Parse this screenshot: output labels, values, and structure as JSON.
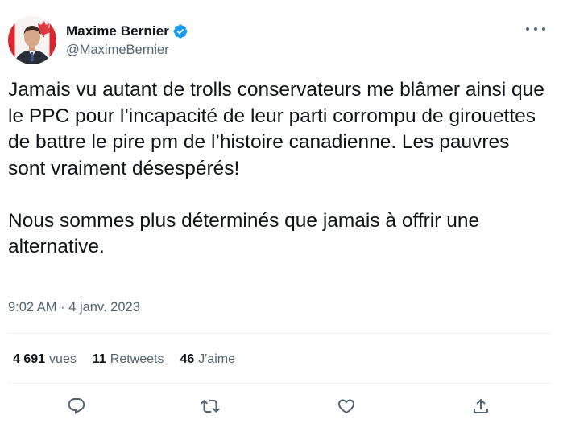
{
  "author": {
    "display_name": "Maxime Bernier",
    "handle": "@MaximeBernier",
    "verified": true,
    "verified_color": "#1d9bf0",
    "avatar_icon": "profile-photo-canada-flag"
  },
  "tweet": {
    "text": "Jamais vu autant de trolls conservateurs me blâmer ainsi que le PPC pour l’incapacité de leur parti corrompu de girouettes de battre le pire pm de l’histoire canadienne. Les pauvres sont vraiment désespérés!\n\nNous sommes plus déterminés que jamais à offrir une alternative.",
    "timestamp": "9:02 AM · 4 janv. 2023"
  },
  "stats": {
    "views_count": "4 691",
    "views_label": "vues",
    "retweets_count": "11",
    "retweets_label": "Retweets",
    "likes_count": "46",
    "likes_label": "J'aime"
  },
  "actions": {
    "reply_icon": "reply-icon",
    "retweet_icon": "retweet-icon",
    "like_icon": "heart-icon",
    "share_icon": "share-icon"
  },
  "colors": {
    "text_primary": "#0f1419",
    "text_secondary": "#536471",
    "divider": "#eff3f4"
  }
}
